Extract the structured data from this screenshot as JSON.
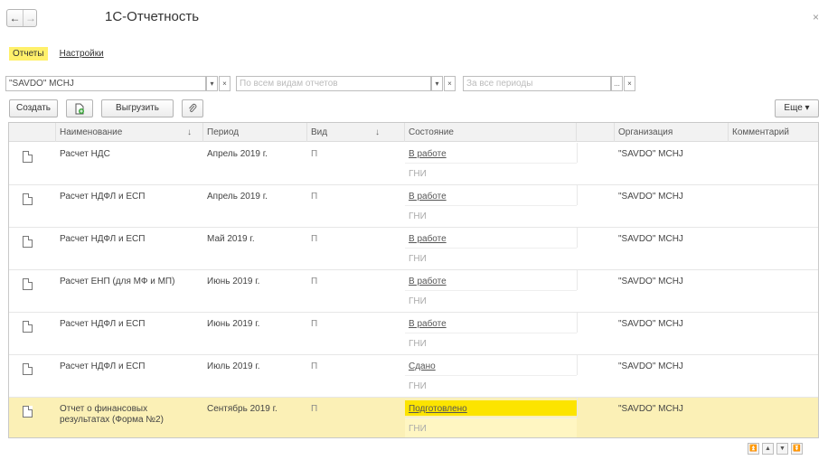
{
  "window": {
    "title": "1С-Отчетность",
    "back_glyph": "←",
    "forward_glyph": "→",
    "close_glyph": "×"
  },
  "tabs": [
    {
      "label": "Отчеты",
      "active": true
    },
    {
      "label": "Настройки",
      "active": false
    }
  ],
  "filters": {
    "organization": {
      "value": "\"SAVDO\" MCHJ"
    },
    "report_type": {
      "placeholder": "По всем видам отчетов"
    },
    "period": {
      "placeholder": "За все периоды"
    },
    "dropdown_glyph": "▾",
    "clear_glyph": "×",
    "choose_glyph": "..."
  },
  "toolbar": {
    "create": "Создать",
    "upload": "Выгрузить",
    "more": "Еще ▾"
  },
  "table": {
    "columns": {
      "name": "Наименование",
      "period": "Период",
      "type": "Вид",
      "state": "Состояние",
      "org": "Организация",
      "comment": "Комментарий",
      "sort_glyph": "↓"
    },
    "rows": [
      {
        "name": "Расчет НДС",
        "name2": "",
        "period": "Апрель 2019 г.",
        "type": "П",
        "state": "В работе",
        "sub": "ГНИ",
        "org": "\"SAVDO\" MCHJ",
        "comment": ""
      },
      {
        "name": "Расчет НДФЛ и ЕСП",
        "name2": "",
        "period": "Апрель 2019 г.",
        "type": "П",
        "state": "В работе",
        "sub": "ГНИ",
        "org": "\"SAVDO\" MCHJ",
        "comment": ""
      },
      {
        "name": "Расчет НДФЛ и ЕСП",
        "name2": "",
        "period": "Май 2019 г.",
        "type": "П",
        "state": "В работе",
        "sub": "ГНИ",
        "org": "\"SAVDO\" MCHJ",
        "comment": ""
      },
      {
        "name": "Расчет ЕНП (для МФ и МП)",
        "name2": "",
        "period": "Июнь 2019 г.",
        "type": "П",
        "state": "В работе",
        "sub": "ГНИ",
        "org": "\"SAVDO\" MCHJ",
        "comment": ""
      },
      {
        "name": "Расчет НДФЛ и ЕСП",
        "name2": "",
        "period": "Июнь 2019 г.",
        "type": "П",
        "state": "В работе",
        "sub": "ГНИ",
        "org": "\"SAVDO\" MCHJ",
        "comment": ""
      },
      {
        "name": "Расчет НДФЛ и ЕСП",
        "name2": "",
        "period": "Июль 2019 г.",
        "type": "П",
        "state": "Сдано",
        "sub": "ГНИ",
        "org": "\"SAVDO\" MCHJ",
        "comment": ""
      },
      {
        "name": "Отчет о финансовых",
        "name2": "результатах (Форма №2)",
        "period": "Сентябрь 2019 г.",
        "type": "П",
        "state": "Подготовлено",
        "sub": "ГНИ",
        "org": "\"SAVDO\" MCHJ",
        "comment": "",
        "selected": true
      }
    ]
  },
  "pager": [
    "⏫",
    "▲",
    "▼",
    "⏬"
  ]
}
